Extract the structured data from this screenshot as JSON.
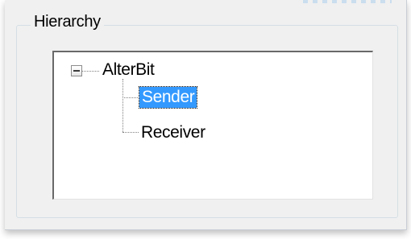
{
  "groupbox": {
    "title": "Hierarchy"
  },
  "tree": {
    "root": {
      "label": "AlterBit",
      "expanded": true,
      "children": [
        {
          "label": "Sender",
          "selected": true
        },
        {
          "label": "Receiver",
          "selected": false
        }
      ]
    },
    "colors": {
      "selection": "#3399ff",
      "selection_text": "#ffffff",
      "connector": "#808080"
    },
    "icons": {
      "expander": "minus-square-icon"
    }
  }
}
